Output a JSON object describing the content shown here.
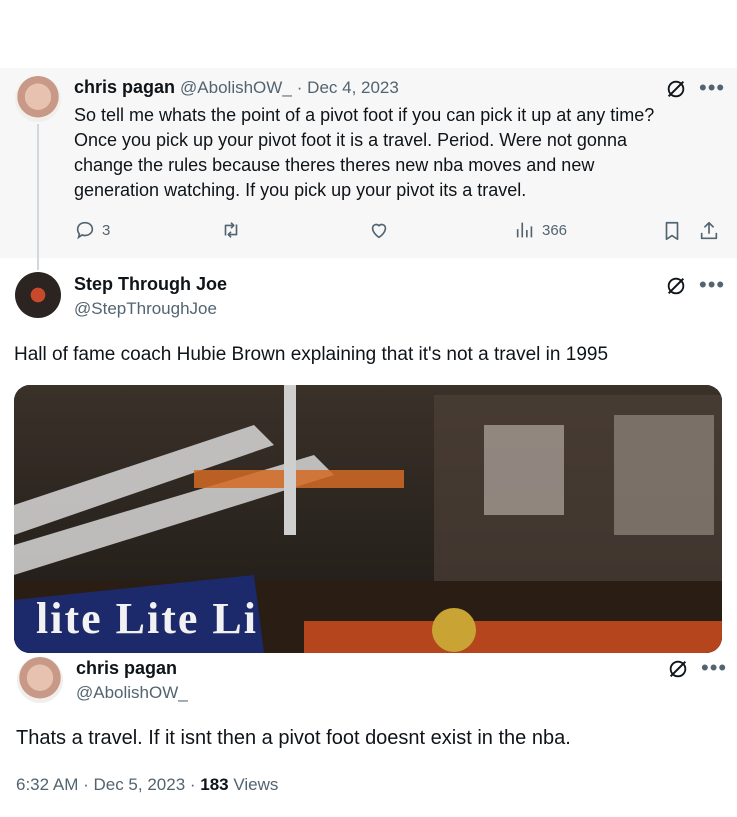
{
  "colors": {
    "muted": "#536471",
    "text": "#0f1419",
    "thread_line": "#cfd9de",
    "highlight_bg": "#f7f7f7"
  },
  "reply_tweet": {
    "author_name": "chris pagan",
    "author_handle": "@AbolishOW_",
    "date": "· Dec 4, 2023",
    "text_lines": [
      "So tell me whats the point of a pivot foot if you can pick it up at any time?",
      "Once you pick up your pivot foot it is a travel. Period. Were not gonna",
      "change the rules because theres theres new nba moves and new",
      "generation watching. If you pick up your pivot its a travel."
    ],
    "replies": "3",
    "views": "366"
  },
  "quoted_tweet": {
    "author_name": "Step Through Joe",
    "author_handle": "@StepThroughJoe",
    "text": "Hall of fame coach Hubie Brown explaining that it's not a travel in 1995",
    "media_banner_text": "lite Lite Li"
  },
  "main_tweet": {
    "author_name": "chris pagan",
    "author_handle": "@AbolishOW_",
    "text": "Thats a travel. If it isnt then a pivot foot doesnt exist in the nba.",
    "timestamp": "6:32 AM · Dec 5, 2023 · ",
    "views_count": "183",
    "views_label": " Views"
  },
  "icons": [
    "grok-icon",
    "more-icon",
    "reply-icon",
    "retweet-icon",
    "like-icon",
    "views-icon",
    "bookmark-icon",
    "share-icon"
  ]
}
